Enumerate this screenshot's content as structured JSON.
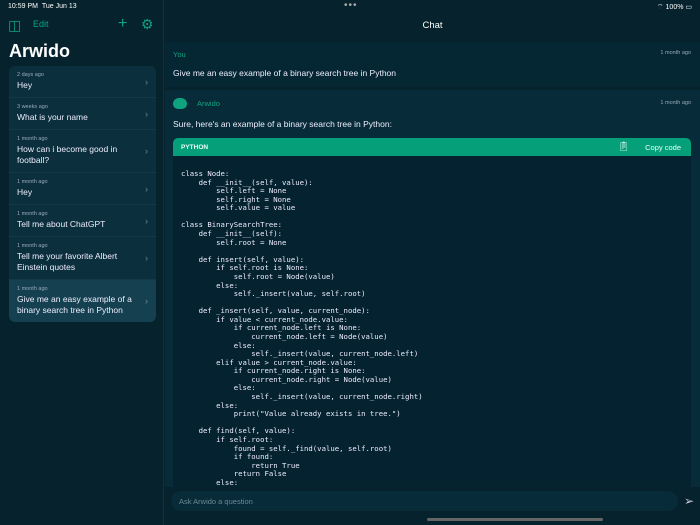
{
  "status": {
    "time": "10:59 PM",
    "date": "Tue Jun 13",
    "battery": "100%"
  },
  "sidebar": {
    "edit": "Edit",
    "title": "Arwido",
    "items": [
      {
        "ago": "2 days ago",
        "text": "Hey"
      },
      {
        "ago": "3 weeks ago",
        "text": "What is your name"
      },
      {
        "ago": "1 month ago",
        "text": "How can i become good in football?"
      },
      {
        "ago": "1 month ago",
        "text": "Hey"
      },
      {
        "ago": "1 month ago",
        "text": "Tell me about ChatGPT"
      },
      {
        "ago": "1 month ago",
        "text": "Tell me your favorite Albert Einstein quotes"
      },
      {
        "ago": "1 month ago",
        "text": "Give me an easy example of a binary search tree in Python"
      }
    ]
  },
  "main": {
    "title": "Chat",
    "you": {
      "name": "You",
      "time": "1 month ago",
      "text": "Give me an easy example of a binary search tree in Python"
    },
    "bot": {
      "name": "Arwido",
      "time": "1 month ago",
      "text": "Sure, here's an example of a binary search tree in Python:",
      "lang": "PYTHON",
      "copy": "Copy code",
      "code": "class Node:\n    def __init__(self, value):\n        self.left = None\n        self.right = None\n        self.value = value\n\nclass BinarySearchTree:\n    def __init__(self):\n        self.root = None\n\n    def insert(self, value):\n        if self.root is None:\n            self.root = Node(value)\n        else:\n            self._insert(value, self.root)\n\n    def _insert(self, value, current_node):\n        if value < current_node.value:\n            if current_node.left is None:\n                current_node.left = Node(value)\n            else:\n                self._insert(value, current_node.left)\n        elif value > current_node.value:\n            if current_node.right is None:\n                current_node.right = Node(value)\n            else:\n                self._insert(value, current_node.right)\n        else:\n            print(\"Value already exists in tree.\")\n\n    def find(self, value):\n        if self.root:\n            found = self._find(value, self.root)\n            if found:\n                return True\n            return False\n        else:"
    },
    "input_placeholder": "Ask Arwido a question"
  }
}
